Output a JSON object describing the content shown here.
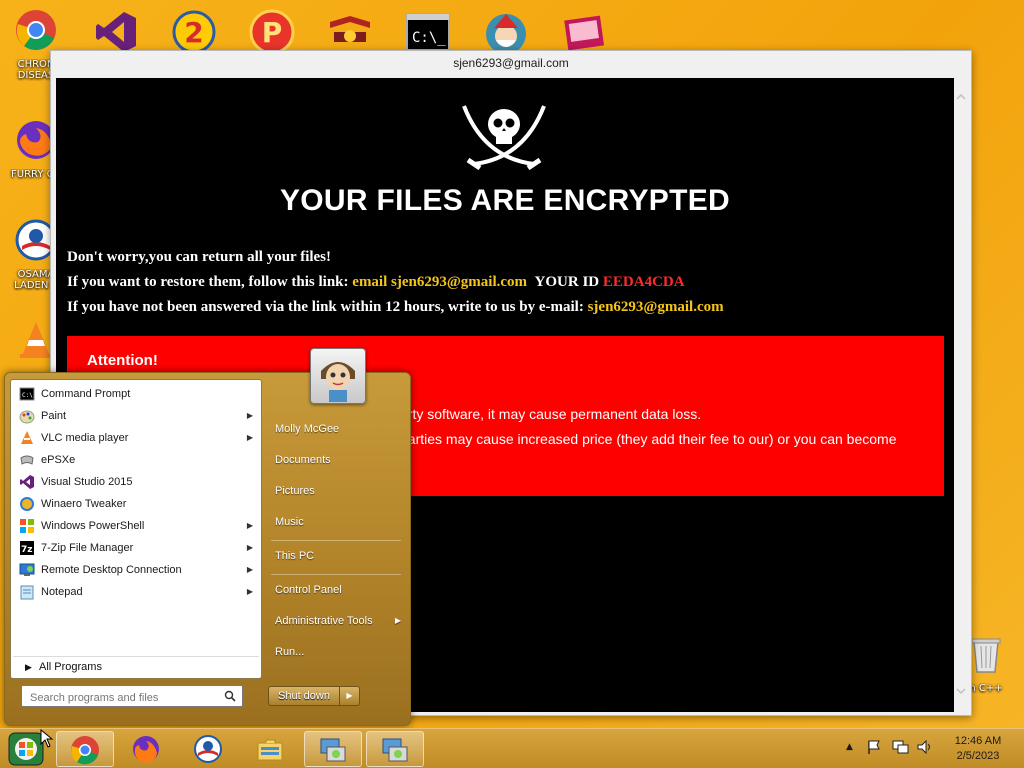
{
  "desktop": {
    "icons": [
      {
        "label": "CHRON\nDISEAS",
        "icon": "chrome-icon"
      },
      {
        "label": "FURRY CU",
        "icon": "firefox-icon"
      },
      {
        "label": "OSAMA\nLADEN E",
        "icon": "obama-logo-icon"
      },
      {
        "label": "",
        "icon": "vlc-icon"
      },
      {
        "label": "n C++",
        "icon": "recycle-bin-icon"
      }
    ],
    "top_icons": [
      "visual-studio-icon",
      "pokemon-icon",
      "p-game-icon",
      "tank-icon",
      "cmd-icon",
      "santa-icon",
      "app-icon"
    ]
  },
  "ransom_window": {
    "title": "sjen6293@gmail.com",
    "headline": "YOUR FILES ARE ENCRYPTED",
    "line1": "Don't worry,you can return all your files!",
    "line2_prefix": "If you want to restore them, follow this link: ",
    "line2_email": "email sjen6293@gmail.com",
    "line2_id_label": "YOUR ID",
    "line2_id": "EEDA4CDA",
    "line3_prefix": "If you have not been answered via the link within 12 hours, write to us by e-mail: ",
    "line3_email": "sjen6293@gmail.com",
    "attention_title": "Attention!",
    "attention_line1": "arty software, it may cause permanent data loss.",
    "attention_line2": "parties may cause increased price (they add their fee to our) or you can become"
  },
  "start_menu": {
    "programs": [
      {
        "label": "Command Prompt",
        "icon": "cmd-icon",
        "submenu": false
      },
      {
        "label": "Paint",
        "icon": "paint-icon",
        "submenu": true
      },
      {
        "label": "VLC media player",
        "icon": "vlc-icon",
        "submenu": true
      },
      {
        "label": "ePSXe",
        "icon": "epsxe-icon",
        "submenu": false
      },
      {
        "label": "Visual Studio 2015",
        "icon": "visual-studio-icon",
        "submenu": false
      },
      {
        "label": "Winaero Tweaker",
        "icon": "winaero-icon",
        "submenu": false
      },
      {
        "label": "Windows PowerShell",
        "icon": "powershell-icon",
        "submenu": true
      },
      {
        "label": "7-Zip File Manager",
        "icon": "7zip-icon",
        "submenu": true
      },
      {
        "label": "Remote Desktop Connection",
        "icon": "remote-desktop-icon",
        "submenu": true
      },
      {
        "label": "Notepad",
        "icon": "notepad-icon",
        "submenu": true
      }
    ],
    "all_programs": "All Programs",
    "search_placeholder": "Search programs and files",
    "right_items": {
      "user": "Molly McGee",
      "documents": "Documents",
      "pictures": "Pictures",
      "music": "Music",
      "this_pc": "This PC",
      "control_panel": "Control Panel",
      "admin_tools": "Administrative Tools",
      "run": "Run..."
    },
    "shutdown": "Shut down"
  },
  "taskbar": {
    "pinned": [
      "chrome-icon",
      "firefox-icon",
      "obama-logo-icon",
      "file-explorer-icon",
      "remote-install-icon",
      "remote-install-icon"
    ],
    "clock_time": "12:46 AM",
    "clock_date": "2/5/2023"
  },
  "colors": {
    "desktop_bg": "#f3a712",
    "ransom_bg": "#000000",
    "attention_bg": "#ff0000",
    "email_yellow": "#f5c518",
    "id_red": "#ff2a2a"
  }
}
